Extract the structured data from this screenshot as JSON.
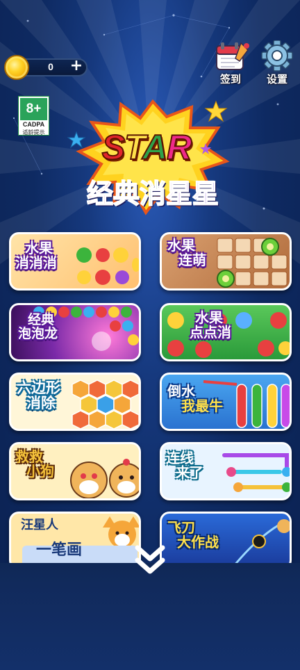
{
  "header": {
    "coins": "0",
    "add_coins_label": "+",
    "checkin_label": "签到",
    "settings_label": "设置"
  },
  "age_rating": {
    "age": "8+",
    "org": "CADPA",
    "note": "适龄提示"
  },
  "logo": {
    "word": [
      "S",
      "T",
      "A",
      "R"
    ],
    "word_colors": [
      "#e2262b",
      "#ffe04a",
      "#2ea24a",
      "#ee2a8a"
    ],
    "subtitle": [
      "经",
      "典",
      "消",
      "星",
      "星"
    ],
    "subtitle_colors": [
      "#e23a2a",
      "#f3c13a",
      "#3aa84a",
      "#9a3ad8",
      "#6a2ad8"
    ]
  },
  "games": [
    {
      "lines": [
        "水果",
        "消消消"
      ]
    },
    {
      "lines": [
        "水果",
        "连萌"
      ]
    },
    {
      "lines": [
        "经典",
        "泡泡龙"
      ]
    },
    {
      "lines": [
        "水果",
        "点点消"
      ]
    },
    {
      "lines": [
        "六边形",
        "消除"
      ]
    },
    {
      "lines": [
        "倒水",
        "我最牛"
      ]
    },
    {
      "lines": [
        "救救",
        "小狗"
      ]
    },
    {
      "lines": [
        "连线",
        "来了"
      ]
    },
    {
      "lines": [
        "汪星人",
        "一笔画"
      ]
    },
    {
      "lines": [
        "飞刀",
        "大作战"
      ]
    }
  ],
  "colors": {
    "background": "#0e2a62",
    "card_border": "#ffffff",
    "title_outline": "#5b1a9a"
  },
  "icons": {
    "scroll_down": "chevron-double-down-icon",
    "checkin": "calendar-checkin-icon",
    "settings": "gear-icon",
    "coin": "coin-icon"
  }
}
